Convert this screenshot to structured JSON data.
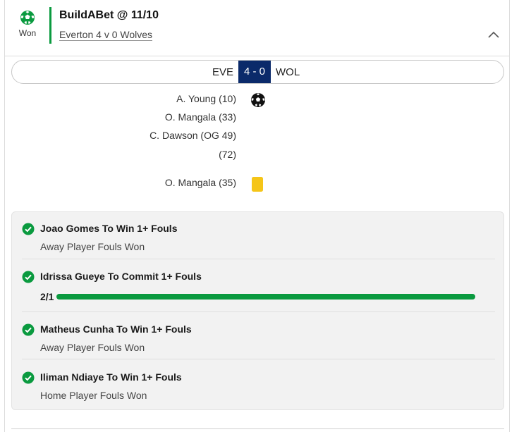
{
  "bet": {
    "status_label": "Won",
    "status_icon": "football-icon",
    "title": "BuildABet @ 11/10",
    "match_link": "Everton 4 v 0 Wolves",
    "accent_color": "#0a9a3f"
  },
  "scoreboard": {
    "home_team": "EVE",
    "score": "4 - 0",
    "away_team": "WOL",
    "score_bg_color": "#0b2a6a"
  },
  "events": {
    "goals": [
      "A. Young (10)",
      "O. Mangala (33)",
      "C. Dawson (OG 49)",
      "(72)"
    ],
    "goal_icon": "football-icon",
    "cards": [
      "O. Mangala (35)"
    ],
    "card_icon": "yellow-card-icon",
    "card_color": "#f5c518"
  },
  "legs": [
    {
      "title": "Joao Gomes To Win 1+ Fouls",
      "subtitle": "Away Player Fouls Won",
      "status": "won"
    },
    {
      "title": "Idrissa Gueye To Commit 1+ Fouls",
      "progress_label": "2/1",
      "progress_fraction": 1.0,
      "status": "won"
    },
    {
      "title": "Matheus Cunha To Win 1+ Fouls",
      "subtitle": "Away Player Fouls Won",
      "status": "won"
    },
    {
      "title": "Iliman Ndiaye To Win 1+ Fouls",
      "subtitle": "Home Player Fouls Won",
      "status": "won"
    }
  ]
}
